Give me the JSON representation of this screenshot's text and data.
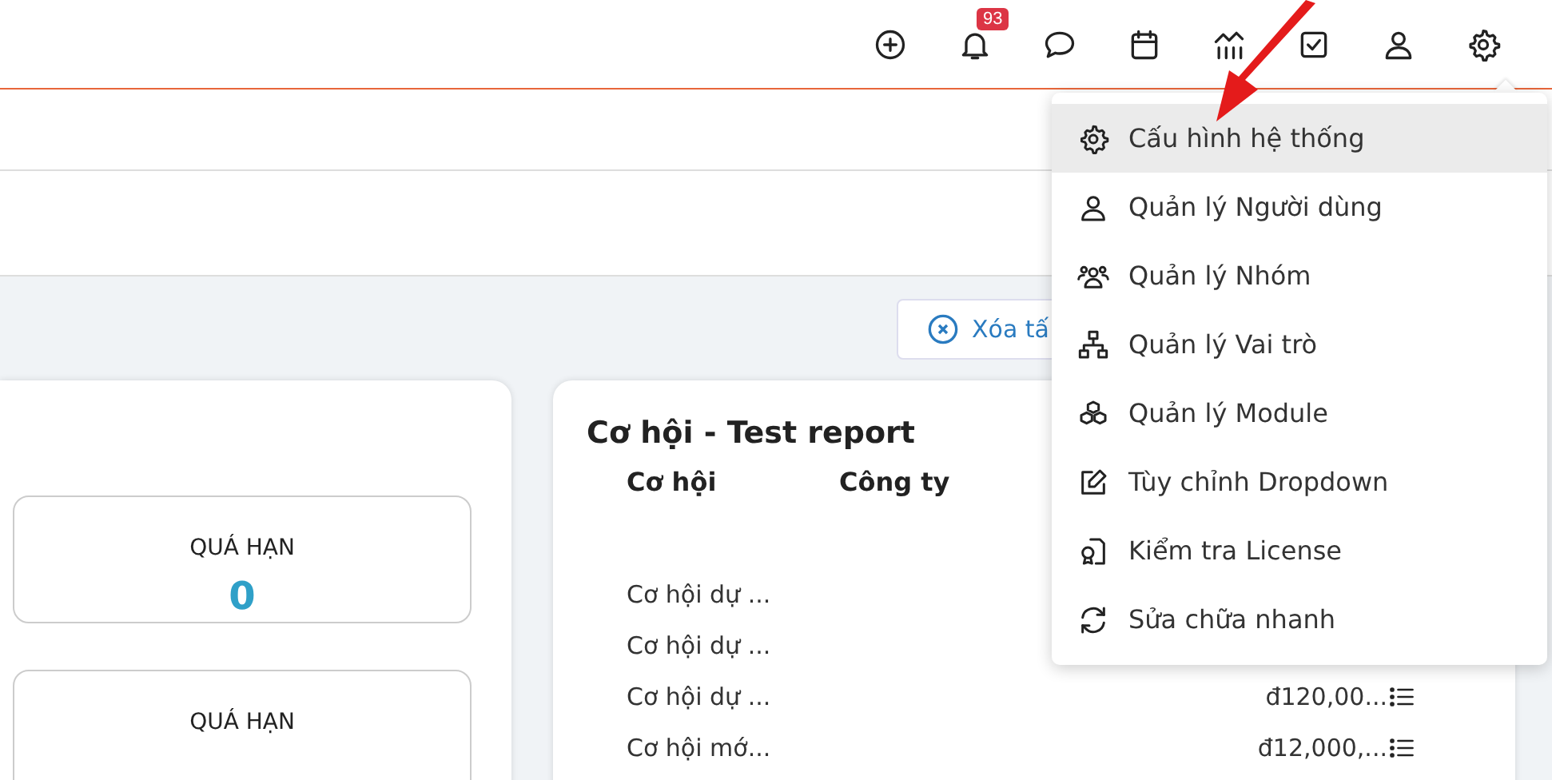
{
  "top_bar": {
    "notification_badge": "93"
  },
  "toolbar": {
    "clear_button": "Xóa tấ"
  },
  "left_card": {
    "stats": [
      {
        "label": "QUÁ HẠN",
        "value": "0"
      },
      {
        "label": "QUÁ HẠN"
      }
    ]
  },
  "report_card": {
    "title": "Cơ hội - Test report",
    "columns": [
      "Cơ hội",
      "Công ty"
    ],
    "rows": [
      {
        "name": "Cơ hội dự ..."
      },
      {
        "name": "Cơ hội dự ..."
      },
      {
        "name": "Cơ hội dự ...",
        "amount": "đ120,00..."
      },
      {
        "name": "Cơ hội mớ...",
        "amount": "đ12,000,..."
      }
    ]
  },
  "settings_menu": {
    "items": [
      {
        "label": "Cấu hình hệ thống",
        "selected": true
      },
      {
        "label": "Quản lý Người dùng",
        "selected": false
      },
      {
        "label": "Quản lý Nhóm",
        "selected": false
      },
      {
        "label": "Quản lý Vai trò",
        "selected": false
      },
      {
        "label": "Quản lý Module",
        "selected": false
      },
      {
        "label": "Tùy chỉnh Dropdown",
        "selected": false
      },
      {
        "label": "Kiểm tra License",
        "selected": false
      },
      {
        "label": "Sửa chữa nhanh",
        "selected": false
      }
    ]
  }
}
